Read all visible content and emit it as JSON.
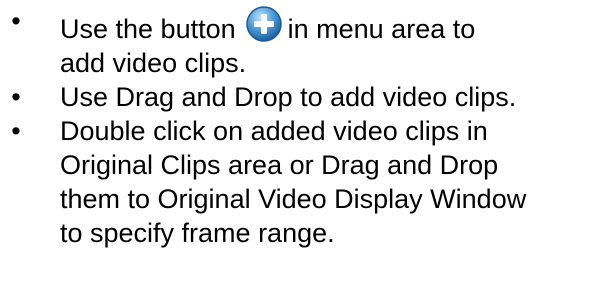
{
  "bullets": [
    {
      "lines": [
        "Use the button",
        "in menu area to",
        "add video clips."
      ],
      "icon": "add-plus-icon"
    },
    {
      "lines": [
        "Use Drag and Drop to add video clips."
      ]
    },
    {
      "lines": [
        "Double click on added video clips in",
        "Original Clips area or Drag and Drop",
        "them to Original Video Display Window",
        "to specify frame range."
      ]
    }
  ],
  "bullet_symbol": "•",
  "colors": {
    "icon_blue": "#2f7fc4",
    "icon_light": "#7fc0ee",
    "text": "#000000"
  }
}
